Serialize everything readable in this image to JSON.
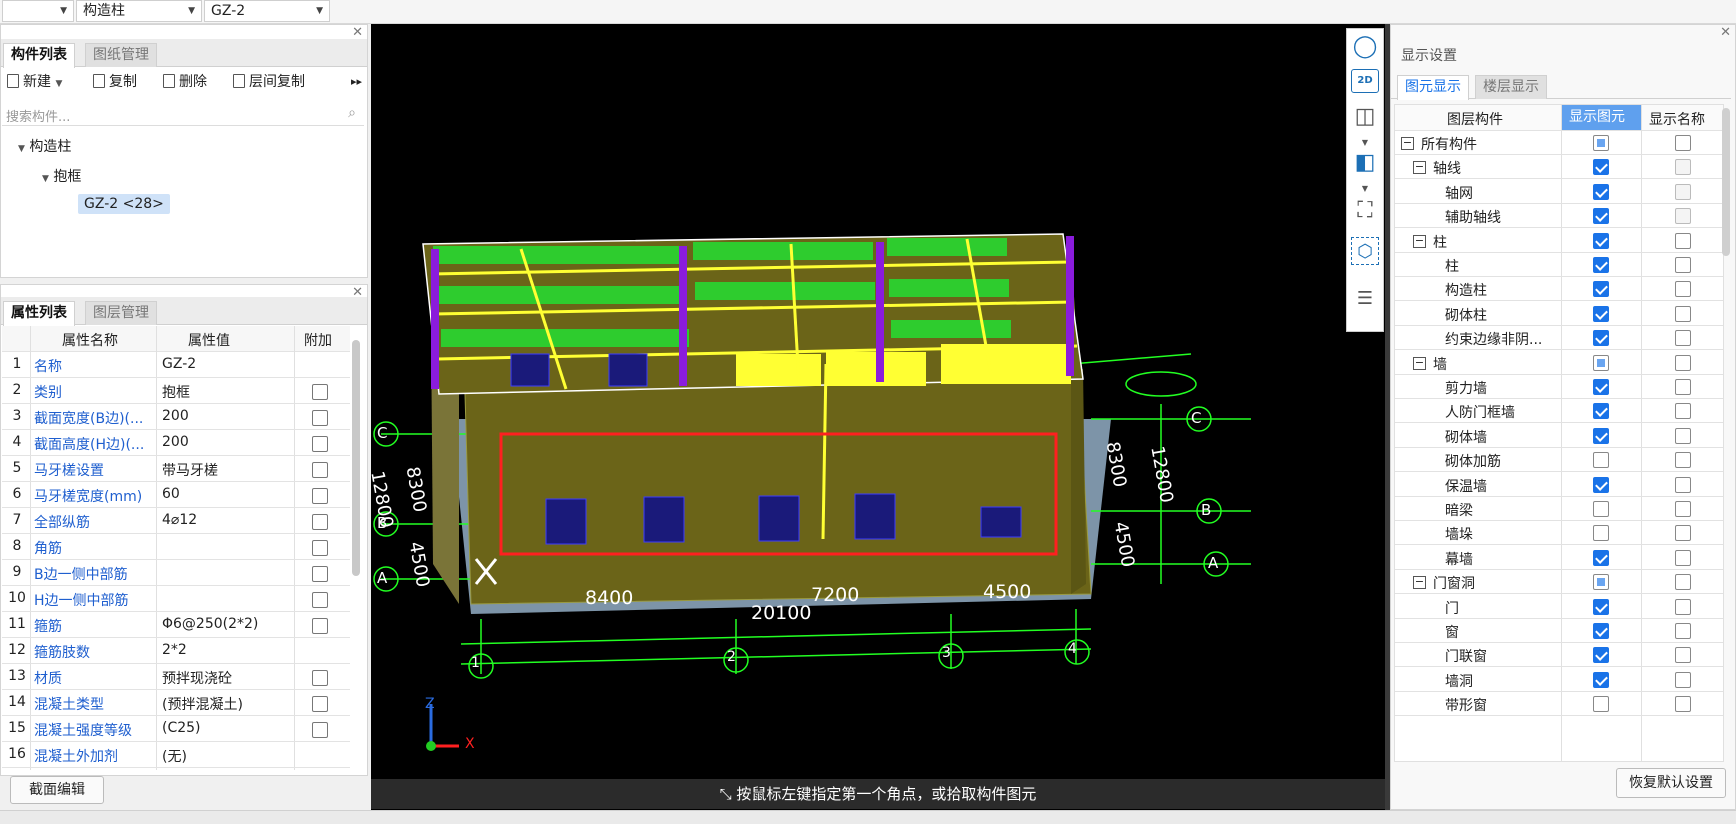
{
  "top": {
    "combo1": "",
    "combo2": "构造柱",
    "combo3": "GZ-2"
  },
  "component_list": {
    "tabs": [
      "构件列表",
      "图纸管理"
    ],
    "toolbar": {
      "new": "新建",
      "copy": "复制",
      "delete": "删除",
      "floor_copy": "层间复制"
    },
    "search_placeholder": "搜索构件...",
    "tree": {
      "root": "构造柱",
      "child": "抱框",
      "leaf": "GZ-2 <28>"
    }
  },
  "properties": {
    "tabs": [
      "属性列表",
      "图层管理"
    ],
    "headers": {
      "name": "属性名称",
      "value": "属性值",
      "extra": "附加"
    },
    "rows": [
      {
        "n": "1",
        "name": "名称",
        "value": "GZ-2",
        "chk": false
      },
      {
        "n": "2",
        "name": "类别",
        "value": "抱框",
        "chk": true
      },
      {
        "n": "3",
        "name": "截面宽度(B边)(...",
        "value": "200",
        "chk": true
      },
      {
        "n": "4",
        "name": "截面高度(H边)(...",
        "value": "200",
        "chk": true
      },
      {
        "n": "5",
        "name": "马牙槎设置",
        "value": "带马牙槎",
        "chk": true
      },
      {
        "n": "6",
        "name": "马牙槎宽度(mm)",
        "value": "60",
        "chk": true
      },
      {
        "n": "7",
        "name": "全部纵筋",
        "value": "4⌀12",
        "chk": true
      },
      {
        "n": "8",
        "name": "角筋",
        "value": "",
        "chk": true
      },
      {
        "n": "9",
        "name": "B边一侧中部筋",
        "value": "",
        "chk": true
      },
      {
        "n": "10",
        "name": "H边一侧中部筋",
        "value": "",
        "chk": true
      },
      {
        "n": "11",
        "name": "箍筋",
        "value": "Φ6@250(2*2)",
        "chk": true
      },
      {
        "n": "12",
        "name": "箍筋肢数",
        "value": "2*2",
        "chk": false
      },
      {
        "n": "13",
        "name": "材质",
        "value": "预拌现浇砼",
        "chk": true
      },
      {
        "n": "14",
        "name": "混凝土类型",
        "value": "(预拌混凝土)",
        "chk": true
      },
      {
        "n": "15",
        "name": "混凝土强度等级",
        "value": "(C25)",
        "chk": true
      },
      {
        "n": "16",
        "name": "混凝土外加剂",
        "value": "(无)",
        "chk": false
      }
    ],
    "section_edit": "截面编辑"
  },
  "viewport": {
    "status": "按鼠标左键指定第一个角点，或拾取构件图元",
    "dims": {
      "d1": "8400",
      "d2": "7200",
      "d3": "4500",
      "total": "20100",
      "left1": "8300",
      "left2": "4500",
      "right1": "8300",
      "right2": "12800",
      "right3": "4500"
    },
    "axes_bottom": [
      "1",
      "2",
      "3",
      "4"
    ],
    "axes_left": [
      "C",
      "B",
      "A"
    ],
    "axes_right": [
      "C",
      "B",
      "A"
    ],
    "axis_x": "X",
    "axis_z": "Z",
    "left_cut": "12800"
  },
  "display": {
    "title": "显示设置",
    "tabs": [
      "图元显示",
      "楼层显示"
    ],
    "headers": {
      "layer": "图层构件",
      "show": "显示图元",
      "name": "显示名称"
    },
    "rows": [
      {
        "label": "所有构件",
        "level": 0,
        "group": true,
        "show": "part",
        "name": "off"
      },
      {
        "label": "轴线",
        "level": 1,
        "group": true,
        "show": "on",
        "name": "dis"
      },
      {
        "label": "轴网",
        "level": 2,
        "group": false,
        "show": "on",
        "name": "dis"
      },
      {
        "label": "辅助轴线",
        "level": 2,
        "group": false,
        "show": "on",
        "name": "dis"
      },
      {
        "label": "柱",
        "level": 1,
        "group": true,
        "show": "on",
        "name": "off"
      },
      {
        "label": "柱",
        "level": 2,
        "group": false,
        "show": "on",
        "name": "off"
      },
      {
        "label": "构造柱",
        "level": 2,
        "group": false,
        "show": "on",
        "name": "off"
      },
      {
        "label": "砌体柱",
        "level": 2,
        "group": false,
        "show": "on",
        "name": "off"
      },
      {
        "label": "约束边缘非阴...",
        "level": 2,
        "group": false,
        "show": "on",
        "name": "off"
      },
      {
        "label": "墙",
        "level": 1,
        "group": true,
        "show": "part",
        "name": "off"
      },
      {
        "label": "剪力墙",
        "level": 2,
        "group": false,
        "show": "on",
        "name": "off"
      },
      {
        "label": "人防门框墙",
        "level": 2,
        "group": false,
        "show": "on",
        "name": "off"
      },
      {
        "label": "砌体墙",
        "level": 2,
        "group": false,
        "show": "on",
        "name": "off"
      },
      {
        "label": "砌体加筋",
        "level": 2,
        "group": false,
        "show": "off",
        "name": "off"
      },
      {
        "label": "保温墙",
        "level": 2,
        "group": false,
        "show": "on",
        "name": "off"
      },
      {
        "label": "暗梁",
        "level": 2,
        "group": false,
        "show": "off",
        "name": "off"
      },
      {
        "label": "墙垛",
        "level": 2,
        "group": false,
        "show": "off",
        "name": "off"
      },
      {
        "label": "幕墙",
        "level": 2,
        "group": false,
        "show": "on",
        "name": "off"
      },
      {
        "label": "门窗洞",
        "level": 1,
        "group": true,
        "show": "part",
        "name": "off"
      },
      {
        "label": "门",
        "level": 2,
        "group": false,
        "show": "on",
        "name": "off"
      },
      {
        "label": "窗",
        "level": 2,
        "group": false,
        "show": "on",
        "name": "off"
      },
      {
        "label": "门联窗",
        "level": 2,
        "group": false,
        "show": "on",
        "name": "off"
      },
      {
        "label": "墙洞",
        "level": 2,
        "group": false,
        "show": "on",
        "name": "off"
      },
      {
        "label": "带形窗",
        "level": 2,
        "group": false,
        "show": "off",
        "name": "off"
      }
    ],
    "restore": "恢复默认设置"
  },
  "colors": {
    "accent": "#1a73e8",
    "property_name": "#1f5fcf",
    "green_line": "#22ff22",
    "wall": "#6b6418",
    "roof": "#2ecc2e",
    "selection": "#ff2020"
  }
}
